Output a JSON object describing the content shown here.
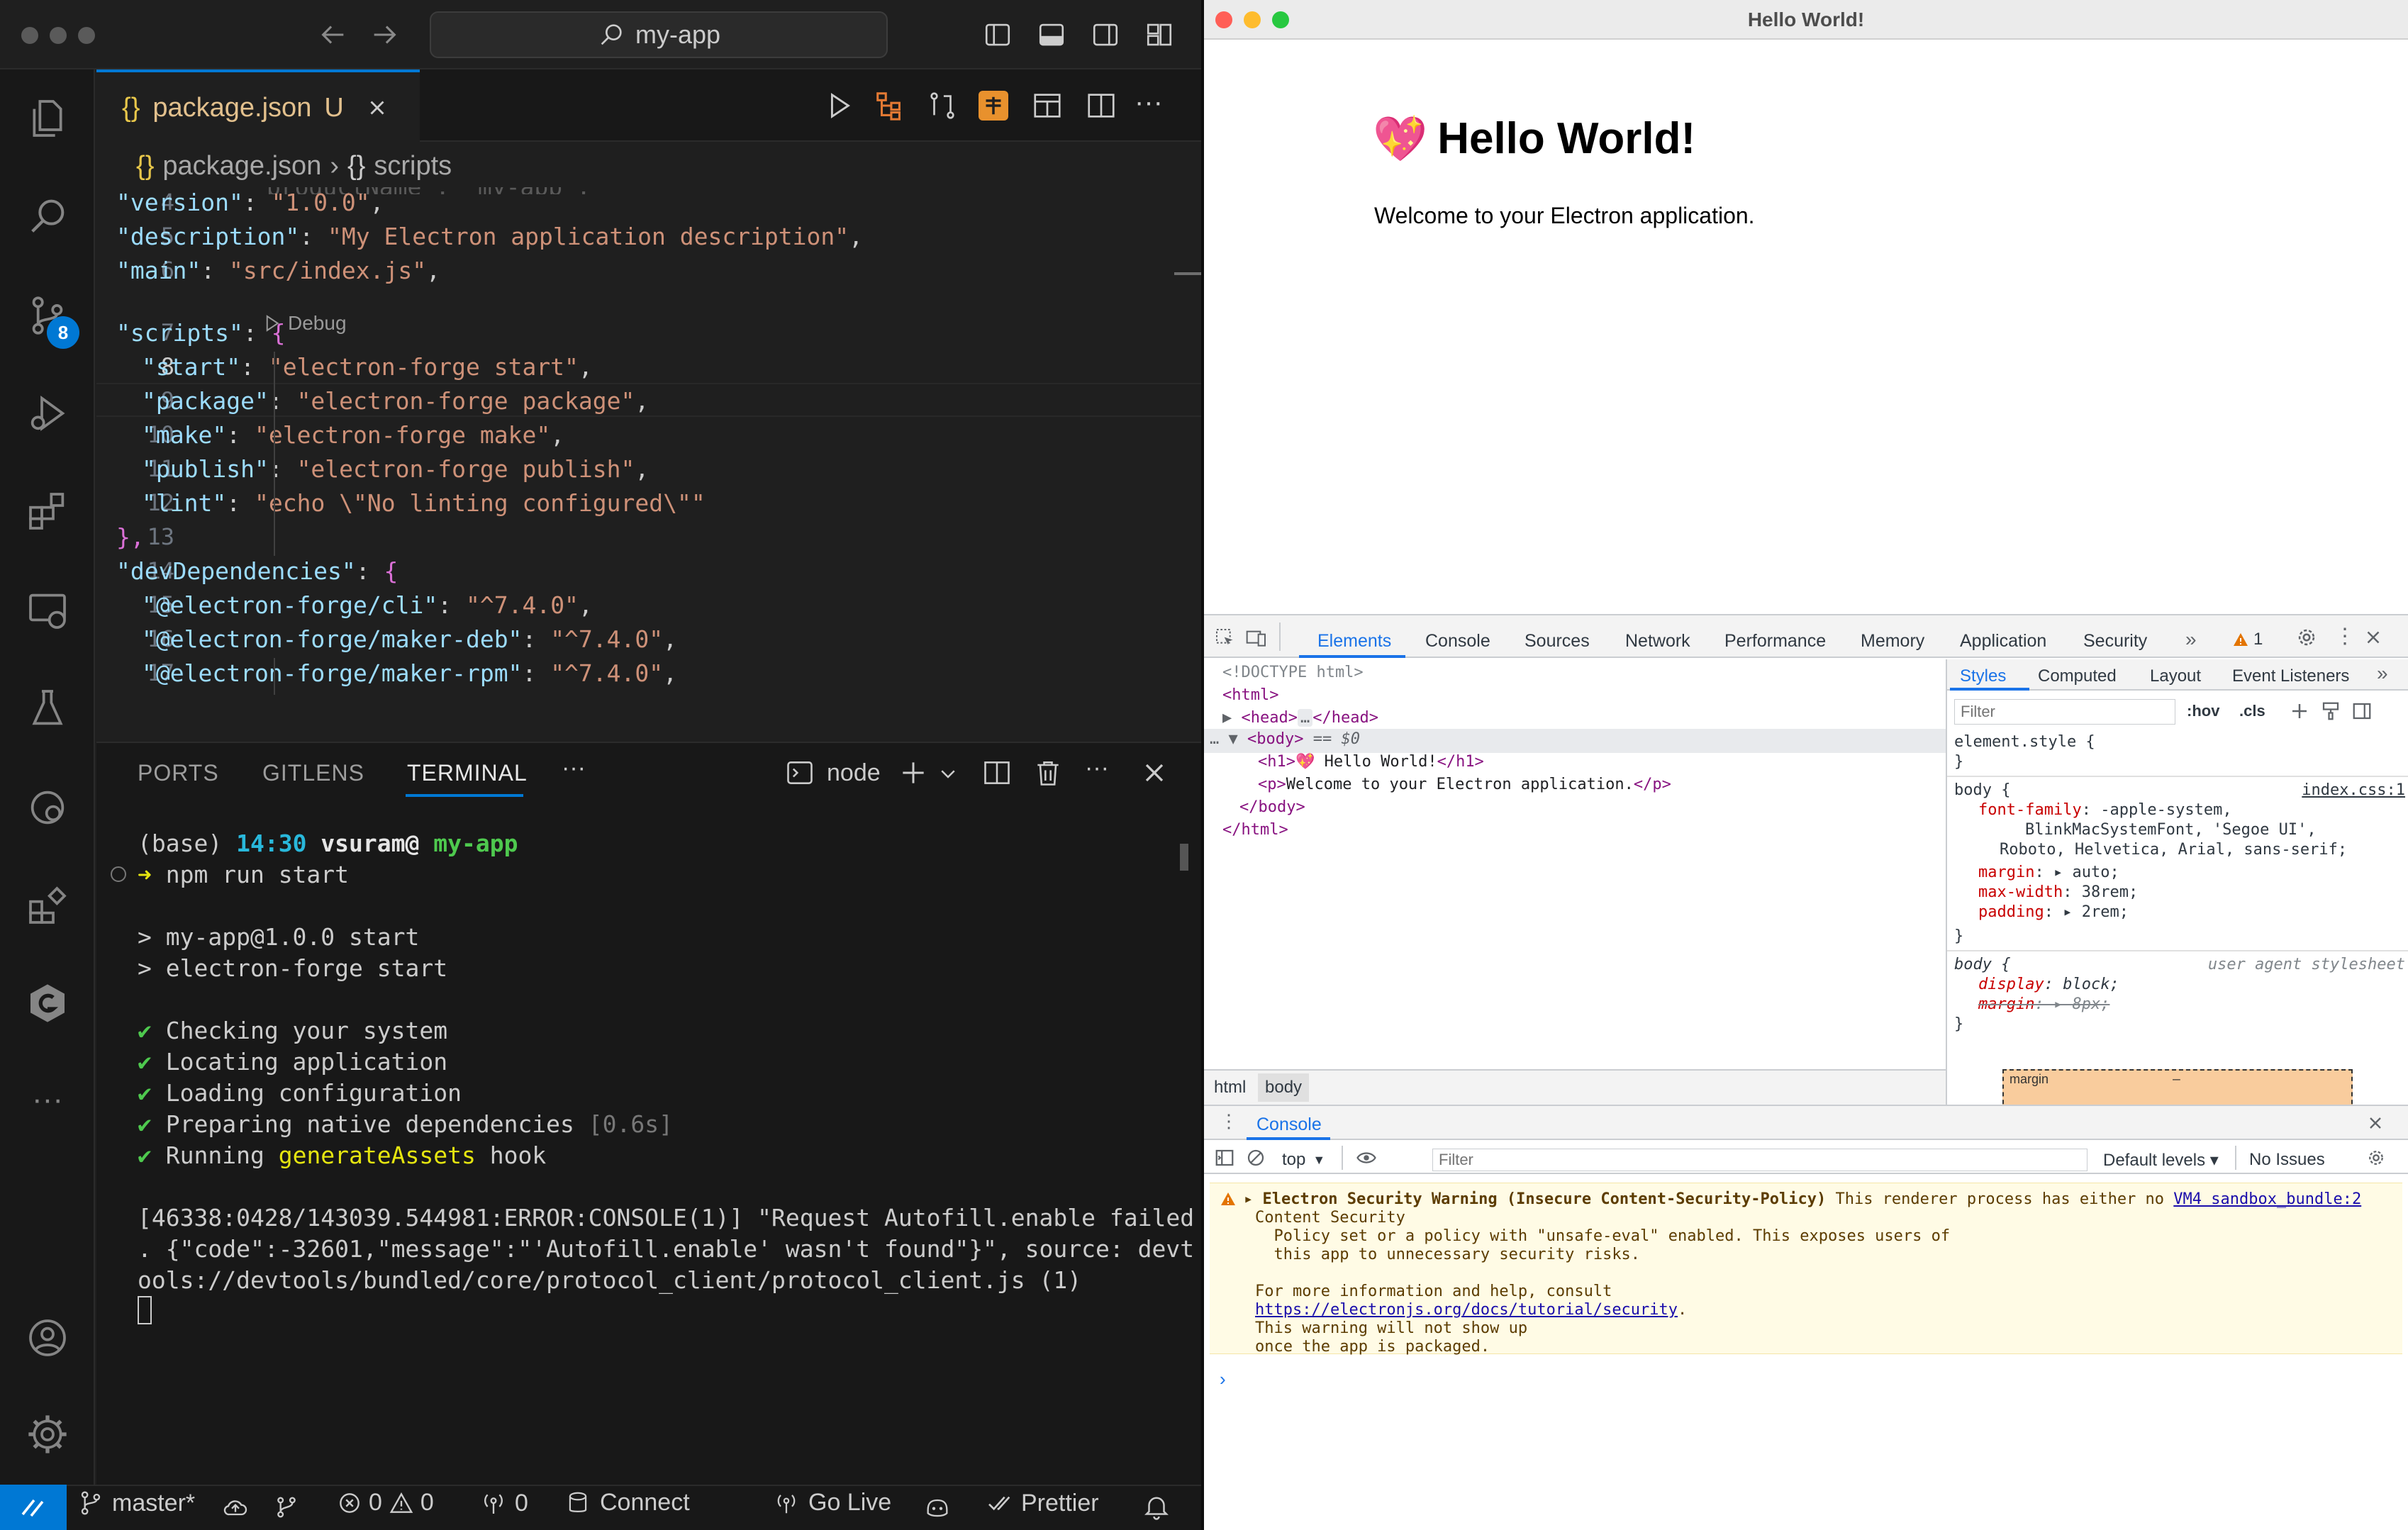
{
  "vscode": {
    "command_center": "my-app",
    "tab": {
      "icon": "{}",
      "name": "package.json",
      "status": "U"
    },
    "breadcrumb": {
      "file": "package.json",
      "section": "scripts",
      "file_icon": "{}",
      "section_icon": "{}"
    },
    "scm_badge": "8",
    "code_lens": "Debug",
    "editor_lines": [
      {
        "n": "4",
        "key": "\"version\"",
        "val": "\"1.0.0\"",
        "tail": ","
      },
      {
        "n": "5",
        "key": "\"description\"",
        "val": "\"My Electron application description\"",
        "tail": ","
      },
      {
        "n": "6",
        "key": "\"main\"",
        "val": "\"src/index.js\"",
        "tail": ","
      },
      {
        "n": "7",
        "key": "\"scripts\"",
        "val": "",
        "tail": "{"
      },
      {
        "n": "8",
        "key": "\"start\"",
        "val": "\"electron-forge start\"",
        "tail": ","
      },
      {
        "n": "9",
        "key": "\"package\"",
        "val": "\"electron-forge package\"",
        "tail": ","
      },
      {
        "n": "10",
        "key": "\"make\"",
        "val": "\"electron-forge make\"",
        "tail": ","
      },
      {
        "n": "11",
        "key": "\"publish\"",
        "val": "\"electron-forge publish\"",
        "tail": ","
      },
      {
        "n": "12",
        "key": "\"lint\"",
        "val": "\"echo \\\"No linting configured\\\"\"",
        "tail": ""
      },
      {
        "n": "13",
        "key": "",
        "val": "",
        "tail": "},"
      },
      {
        "n": "14",
        "key": "\"devDependencies\"",
        "val": "",
        "tail": "{"
      },
      {
        "n": "15",
        "key": "\"@electron-forge/cli\"",
        "val": "\"^7.4.0\"",
        "tail": ","
      },
      {
        "n": "16",
        "key": "\"@electron-forge/maker-deb\"",
        "val": "\"^7.4.0\"",
        "tail": ","
      },
      {
        "n": "17",
        "key": "\"@electron-forge/maker-rpm\"",
        "val": "\"^7.4.0\"",
        "tail": ","
      }
    ],
    "panel_tabs": [
      "PORTS",
      "GITLENS",
      "TERMINAL"
    ],
    "terminal_name": "node",
    "terminal": {
      "prompt_env": "(base)",
      "prompt_time": "14:30",
      "prompt_user": "vsuram@",
      "prompt_dir": "my-app",
      "command": "npm run start",
      "out1": "> my-app@1.0.0 start",
      "out2": "> electron-forge start",
      "checks": [
        "Checking your system",
        "Locating application",
        "Loading configuration",
        "Preparing native dependencies",
        "Running "
      ],
      "check_time": "[0.6s]",
      "hook_name": "generateAssets",
      "hook_tail": " hook",
      "error1": "[46338:0428/143039.544981:ERROR:CONSOLE(1)] \"Request Autofill.enable failed",
      "error2": ". {\"code\":-32601,\"message\":\"'Autofill.enable' wasn't found\"}\", source: devt",
      "error3": "ools://devtools/bundled/core/protocol_client/protocol_client.js (1)"
    },
    "status": {
      "branch": "master*",
      "errors": "0",
      "warnings": "0",
      "ports": "0",
      "connect": "Connect",
      "golive": "Go Live",
      "prettier": "Prettier"
    }
  },
  "electron": {
    "window_title": "Hello World!",
    "heading_emoji": "💖",
    "heading": "Hello World!",
    "paragraph": "Welcome to your Electron application.",
    "devtools": {
      "tabs": [
        "Elements",
        "Console",
        "Sources",
        "Network",
        "Performance",
        "Memory",
        "Application",
        "Security"
      ],
      "warning_count": "1",
      "dom": {
        "doctype": "<!DOCTYPE html>",
        "html_open": "<html>",
        "head": "<head>",
        "head_close": "</head>",
        "body_open": "<body>",
        "body_eq": "== $0",
        "h1_open": "<h1>",
        "h1_text": "💖 Hello World!",
        "h1_close": "</h1>",
        "p_open": "<p>",
        "p_text": "Welcome to your Electron application.",
        "p_close": "</p>",
        "body_close": "</body>",
        "html_close": "</html>"
      },
      "crumbs": [
        "html",
        "body"
      ],
      "styles_tabs": [
        "Styles",
        "Computed",
        "Layout",
        "Event Listeners"
      ],
      "filter_placeholder": "Filter",
      "hov": ":hov",
      "cls": ".cls",
      "element_style": "element.style {",
      "rule1_selector": "body {",
      "rule1_source": "index.css:1",
      "rule1_props": [
        {
          "name": "font-family",
          "value": "-apple-system,"
        },
        {
          "name": "",
          "value": "BlinkMacSystemFont, 'Segoe UI',"
        },
        {
          "name": "",
          "value": "Roboto, Helvetica, Arial, sans-serif;"
        },
        {
          "name": "margin",
          "value": "auto;"
        },
        {
          "name": "max-width",
          "value": "38rem;"
        },
        {
          "name": "padding",
          "value": "2rem;"
        }
      ],
      "rule2_selector": "body {",
      "rule2_source": "user agent stylesheet",
      "rule2_props": [
        {
          "name": "display",
          "value": "block;"
        },
        {
          "name": "margin",
          "value": "8px;"
        }
      ],
      "box_model_label": "margin",
      "box_model_value": "–",
      "drawer_title": "Console",
      "context": "top",
      "console_filter": "Filter",
      "levels": "Default levels",
      "issues": "No Issues",
      "warning": {
        "title": "Electron Security Warning (Insecure Content-Security-Policy)",
        "after_title": " This renderer process has either no ",
        "source_link": "VM4 sandbox_bundle:2",
        "line2": "Content Security",
        "line3": "  Policy set or a policy with \"unsafe-eval\" enabled. This exposes users of",
        "line4": "  this app to unnecessary security risks.",
        "line5": "For more information and help, consult",
        "link": "https://electronjs.org/docs/tutorial/security",
        "line6": "This warning will not show up",
        "line7": "once the app is packaged."
      }
    }
  },
  "colors": {
    "accent": "#0078d4",
    "terminal_green": "#4ec94e",
    "terminal_yellow": "#e5e510",
    "warning_bg": "#fffbe5"
  }
}
